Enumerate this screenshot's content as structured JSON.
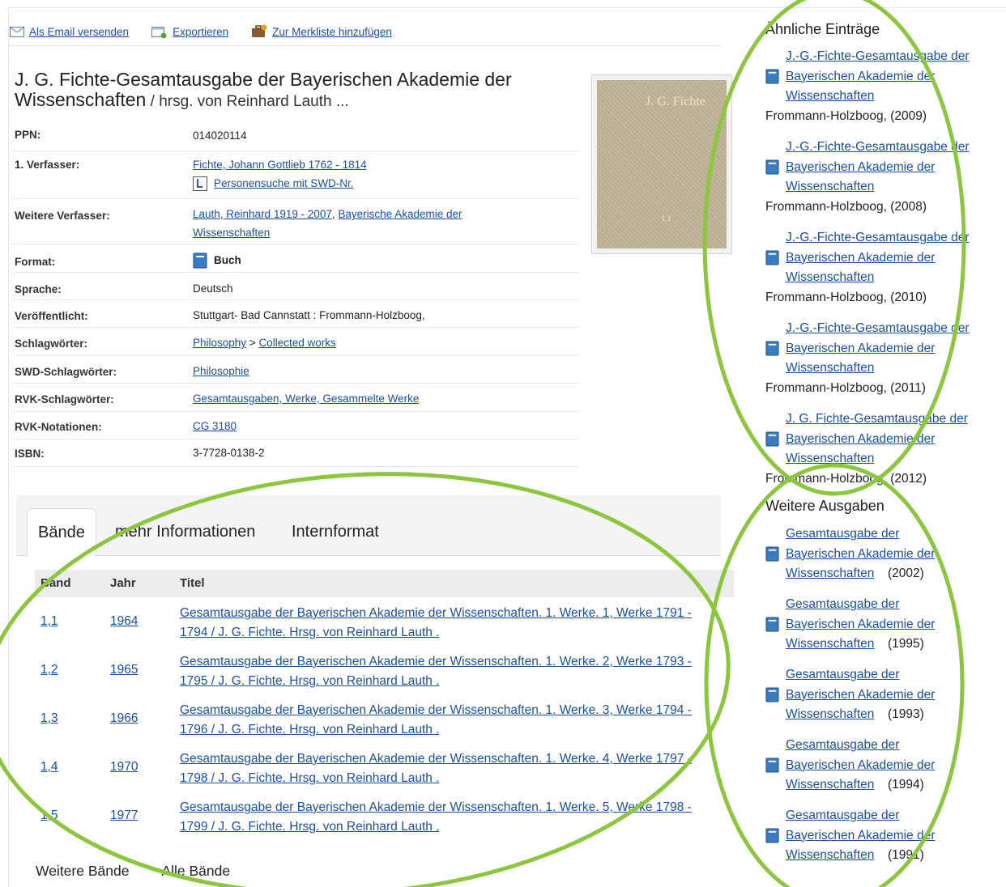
{
  "actions": {
    "email": "Als Email versenden",
    "export": "Exportieren",
    "bookmark": "Zur Merkliste hinzufügen"
  },
  "record": {
    "title_main": "J. G. Fichte-Gesamtausgabe der Bayerischen Akademie der Wissenschaften",
    "title_resp": " / hrsg. von Reinhard Lauth ...",
    "cover_text": "J. G. Fichte",
    "cover_vol": "I,1"
  },
  "details": {
    "ppn_label": "PPN:",
    "ppn": "014020114",
    "author_label": "1. Verfasser:",
    "author": "Fichte, Johann Gottlieb 1762 - 1814",
    "author_search": "Personensuche mit SWD-Nr.",
    "coauthors_label": "Weitere Verfasser:",
    "coauthor1": "Lauth, Reinhard 1919 - 2007",
    "coauthor_sep": ", ",
    "coauthor2": "Bayerische Akademie der Wissenschaften",
    "format_label": "Format:",
    "format": "Buch",
    "language_label": "Sprache:",
    "language": "Deutsch",
    "published_label": "Veröffentlicht:",
    "published": "Stuttgart- Bad Cannstatt : Frommann-Holzboog,",
    "subjects_label": "Schlagwörter:",
    "subject1": "Philosophy",
    "subject_sep": " > ",
    "subject2": "Collected works",
    "swd_label": "SWD-Schlagwörter:",
    "swd": "Philosophie",
    "rvk_subjects_label": "RVK-Schlagwörter:",
    "rvk_subjects": "Gesamtausgaben, Werke, Gesammelte Werke",
    "rvk_notation_label": "RVK-Notationen:",
    "rvk_notation": "CG 3180",
    "isbn_label": "ISBN:",
    "isbn": "3-7728-0138-2"
  },
  "tabs": {
    "volumes": "Bände",
    "more_info": "mehr Informationen",
    "internal": "Internformat"
  },
  "volumes": {
    "headers": {
      "band": "Band",
      "year": "Jahr",
      "title": "Titel"
    },
    "rows": [
      {
        "band": "1,1",
        "year": "1964",
        "title": "Gesamtausgabe der Bayerischen Akademie der Wissenschaften. 1. Werke. 1, Werke 1791 - 1794 / J. G. Fichte. Hrsg. von Reinhard Lauth ."
      },
      {
        "band": "1,2",
        "year": "1965",
        "title": "Gesamtausgabe der Bayerischen Akademie der Wissenschaften. 1. Werke. 2, Werke 1793 - 1795 / J. G. Fichte. Hrsg. von Reinhard Lauth ."
      },
      {
        "band": "1,3",
        "year": "1966",
        "title": "Gesamtausgabe der Bayerischen Akademie der Wissenschaften. 1. Werke. 3, Werke 1794 - 1796 / J. G. Fichte. Hrsg. von Reinhard Lauth ."
      },
      {
        "band": "1,4",
        "year": "1970",
        "title": "Gesamtausgabe der Bayerischen Akademie der Wissenschaften. 1. Werke. 4, Werke 1797 - 1798 / J. G. Fichte. Hrsg. von Reinhard Lauth ."
      },
      {
        "band": "1,5",
        "year": "1977",
        "title": "Gesamtausgabe der Bayerischen Akademie der Wissenschaften. 1. Werke. 5, Werke 1798 - 1799 / J. G. Fichte. Hrsg. von Reinhard Lauth ."
      }
    ],
    "more": "Weitere Bände",
    "all": "Alle Bände"
  },
  "similar": {
    "heading": "Ähnliche Einträge",
    "items": [
      {
        "title": "J.-G.-Fichte-Gesamtausgabe der Bayerischen Akademie der Wissenschaften",
        "pub": "Frommann-Holzboog, (2009)"
      },
      {
        "title": "J.-G.-Fichte-Gesamtausgabe der Bayerischen Akademie der Wissenschaften",
        "pub": "Frommann-Holzboog, (2008)"
      },
      {
        "title": "J.-G.-Fichte-Gesamtausgabe der Bayerischen Akademie der Wissenschaften",
        "pub": "Frommann-Holzboog, (2010)"
      },
      {
        "title": "J.-G.-Fichte-Gesamtausgabe der Bayerischen Akademie der Wissenschaften",
        "pub": "Frommann-Holzboog, (2011)"
      },
      {
        "title": "J. G. Fichte-Gesamtausgabe der Bayerischen Akademie der Wissenschaften",
        "pub": "Frommann-Holzboog, (2012)"
      }
    ]
  },
  "editions": {
    "heading": "Weitere Ausgaben",
    "items": [
      {
        "title": "Gesamtausgabe der Bayerischen Akademie der Wissenschaften",
        "year": "(2002)"
      },
      {
        "title": "Gesamtausgabe der Bayerischen Akademie der Wissenschaften",
        "year": "(1995)"
      },
      {
        "title": "Gesamtausgabe der Bayerischen Akademie der Wissenschaften",
        "year": "(1993)"
      },
      {
        "title": "Gesamtausgabe der Bayerischen Akademie der Wissenschaften",
        "year": "(1994)"
      },
      {
        "title": "Gesamtausgabe der Bayerischen Akademie der Wissenschaften",
        "year": "(1991)"
      }
    ]
  },
  "colors": {
    "link": "#1a4f9c",
    "highlight": "#8cc63f",
    "book_icon": "#3b7bbf"
  }
}
